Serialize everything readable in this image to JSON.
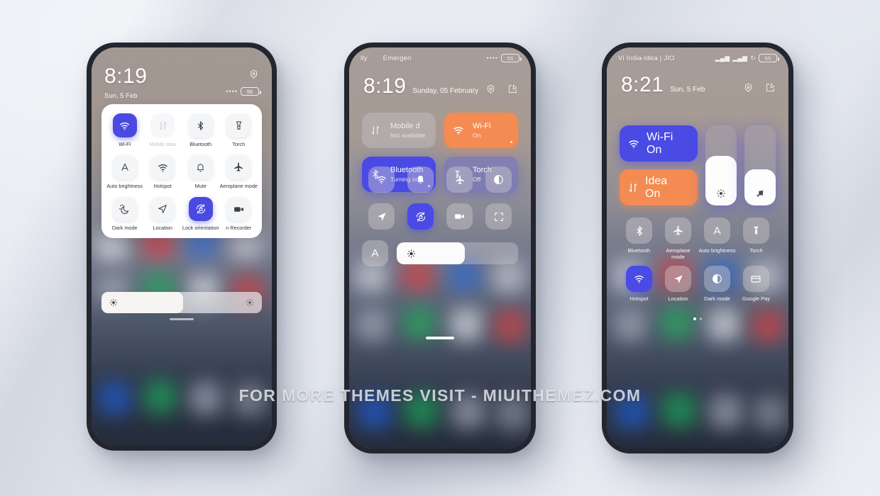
{
  "watermark": "FOR MORE THEMES VISIT - MIUITHEMEZ.COM",
  "colors": {
    "accent_blue": "#4a4ae4",
    "accent_orange": "#f38b52",
    "card_white": "#ffffff",
    "frame_dark": "#23262e"
  },
  "phone1": {
    "status": {
      "battery": "55",
      "signal_dots": "••••"
    },
    "time": "8:19",
    "date": "Sun, 5 Feb",
    "gear_icon": "settings-gear-icon",
    "tiles": [
      {
        "label": "Wi-Fi",
        "icon": "wifi-icon",
        "state": "on"
      },
      {
        "label": "Mobile data",
        "icon": "mobile-data-icon",
        "state": "disabled"
      },
      {
        "label": "Bluetooth",
        "icon": "bluetooth-icon",
        "state": "off"
      },
      {
        "label": "Torch",
        "icon": "torch-icon",
        "state": "off"
      },
      {
        "label": "Auto brightness",
        "icon": "auto-brightness-icon",
        "state": "off"
      },
      {
        "label": "Hotspot",
        "icon": "hotspot-icon",
        "state": "off"
      },
      {
        "label": "Mute",
        "icon": "bell-icon",
        "state": "off"
      },
      {
        "label": "Aeroplane mode",
        "icon": "aeroplane-icon",
        "state": "off"
      },
      {
        "label": "Dark mode",
        "icon": "dark-mode-icon",
        "state": "off"
      },
      {
        "label": "Location",
        "icon": "location-icon",
        "state": "off"
      },
      {
        "label": "Lock orientation",
        "icon": "lock-orientation-icon",
        "state": "on"
      },
      {
        "label": "n Recorder",
        "icon": "screen-recorder-icon",
        "state": "off"
      }
    ],
    "brightness": {
      "icon_left": "brightness-icon",
      "icon_right": "brightness-icon",
      "value_percent": 50
    }
  },
  "phone2": {
    "status": {
      "carrier_left": "lly",
      "carrier_right": "Emergen",
      "battery": "55",
      "signal_dots": "••••"
    },
    "time": "8:19",
    "date": "Sunday, 05 February",
    "gear_icon": "settings-gear-icon",
    "edit_icon": "edit-icon",
    "big_tiles": [
      {
        "name": "Mobile d",
        "sub": "Not available",
        "icon": "mobile-data-icon",
        "style": "grey"
      },
      {
        "name": "Wi-Fi",
        "sub": "On",
        "icon": "wifi-icon",
        "style": "orange"
      },
      {
        "name": "Bluetooth",
        "sub": "Turning on...",
        "icon": "bluetooth-icon",
        "style": "blue"
      },
      {
        "name": "Torch",
        "sub": "Off",
        "icon": "torch-icon",
        "style": "blueglass"
      }
    ],
    "icon_row_1": [
      {
        "icon": "hotspot-icon",
        "state": "off"
      },
      {
        "icon": "bell-icon",
        "state": "off"
      },
      {
        "icon": "aeroplane-icon",
        "state": "off"
      },
      {
        "icon": "dark-mode-icon",
        "state": "off"
      }
    ],
    "icon_row_2": [
      {
        "icon": "location-icon",
        "state": "off"
      },
      {
        "icon": "lock-orientation-icon",
        "state": "on"
      },
      {
        "icon": "screen-recorder-icon",
        "state": "off"
      },
      {
        "icon": "scanner-icon",
        "state": "off"
      }
    ],
    "brightness": {
      "auto_label": "A",
      "icon": "brightness-icon",
      "value_percent": 56
    }
  },
  "phone3": {
    "status": {
      "carrier": "Vi India-Idea | JIO",
      "battery": "55"
    },
    "time": "8:21",
    "date": "Sun, 5 Feb",
    "gear_icon": "settings-gear-icon",
    "edit_icon": "edit-icon",
    "big_tiles": [
      {
        "name": "Wi-Fi",
        "sub": "On",
        "icon": "wifi-icon",
        "style": "blue"
      },
      {
        "name": "Idea",
        "sub": "On",
        "icon": "mobile-data-icon",
        "style": "orange"
      }
    ],
    "sliders": [
      {
        "name": "brightness-slider",
        "icon": "brightness-icon",
        "value_percent": 62
      },
      {
        "name": "volume-slider",
        "icon": "music-note-icon",
        "value_percent": 45
      }
    ],
    "icon_row_1": [
      {
        "label": "Bluetooth",
        "icon": "bluetooth-icon",
        "state": "off"
      },
      {
        "label": "Aeroplane mode",
        "icon": "aeroplane-icon",
        "state": "off"
      },
      {
        "label": "Auto brightness",
        "icon": "auto-brightness-icon",
        "state": "off"
      },
      {
        "label": "Torch",
        "icon": "torch-icon",
        "state": "off"
      }
    ],
    "icon_row_2": [
      {
        "label": "Hotspot",
        "icon": "hotspot-icon",
        "state": "on"
      },
      {
        "label": "Location",
        "icon": "location-icon",
        "state": "off"
      },
      {
        "label": "Dark mode",
        "icon": "dark-mode-icon",
        "state": "off"
      },
      {
        "label": "Google Pay",
        "icon": "card-icon",
        "state": "off"
      }
    ],
    "page_dots": {
      "count": 2,
      "active": 0
    }
  }
}
